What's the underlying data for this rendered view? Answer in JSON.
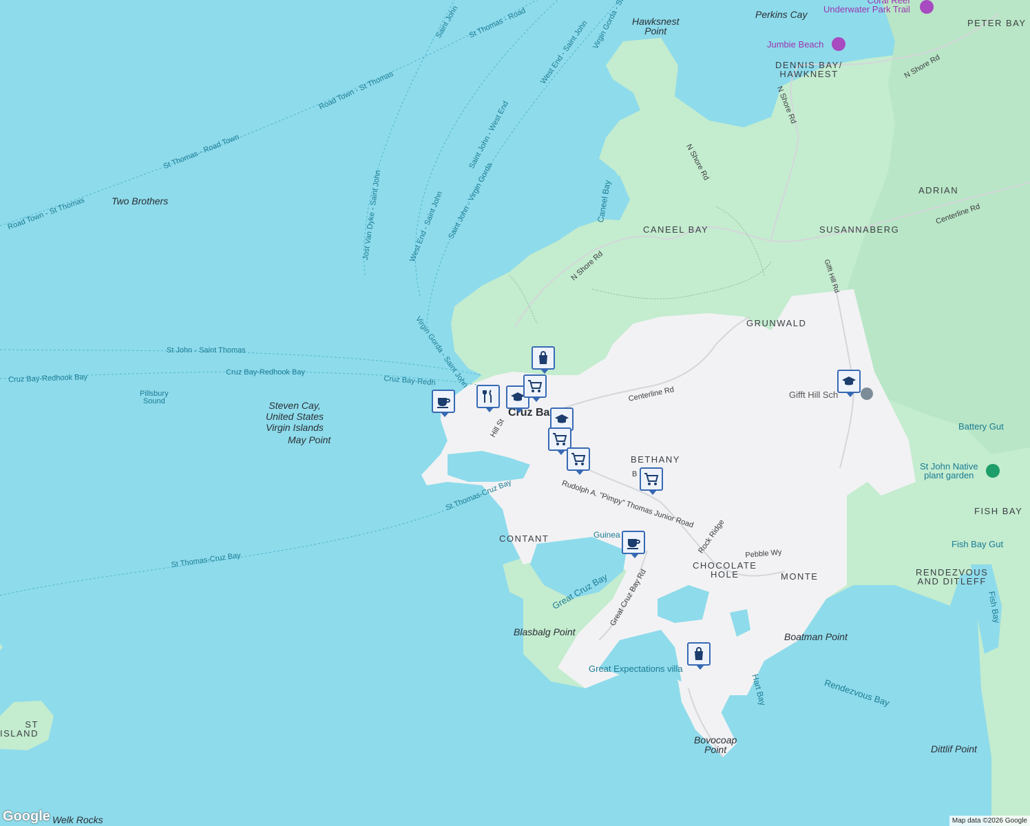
{
  "colors": {
    "water": "#8edbeb",
    "land": "#f2f2f4",
    "park": "#c4eccf",
    "pin": "#3769b3"
  },
  "places": {
    "hawksnest": "Hawksnest\nPoint",
    "perkins": "Perkins Cay",
    "coral_reef": "Coral Reef\nUnderwater Park Trail",
    "jumbie": "Jumbie Beach",
    "peter_bay": "PETER BAY",
    "dennis_bay": "DENNIS BAY/\nHAWKNEST",
    "adrian": "ADRIAN",
    "susannaberg": "SUSANNABERG",
    "caneel_bay": "CANEEL BAY",
    "caneel_bay_water": "Caneel Bay",
    "grunwald": "GRUNWALD",
    "gifft_hill": "Gifft Hill Sch",
    "battery_gut": "Battery Gut",
    "native_garden": "St John Native\nplant garden",
    "fish_bay": "FISH BAY",
    "fish_bay_gut": "Fish Bay Gut",
    "rendezvous": "RENDEZVOUS\nAND DITLEFF",
    "fish_bay_water": "Fish Bay",
    "bethany": "BETHANY",
    "contant": "CONTANT",
    "chocolate_hole": "CHOCOLATE\nHOLE",
    "monte": "MONTE",
    "great_cruz_bay": "Great Cruz Bay",
    "blasbalg": "Blasbalg Point",
    "boatman": "Boatman Point",
    "great_expectations": "Great Expectations villa",
    "hart_bay": "Hart Bay",
    "rendezvous_bay": "Rendezvous Bay",
    "dittlif": "Dittlif Point",
    "bovocoap": "Bovocoap\nPoint",
    "two_brothers": "Two Brothers",
    "pillsbury": "Pillsbury\nSound",
    "steven_cay": "Steven Cay,\nUnited States\nVirgin Islands",
    "may_point": "May Point",
    "cruz_bay": "Cruz Bay",
    "st_island": "ST\nISLAND",
    "welk_rocks": "Welk Rocks",
    "guinea": "Guinea"
  },
  "roads": {
    "n_shore_1": "N Shore Rd",
    "n_shore_2": "N Shore Rd",
    "n_shore_3": "N Shore Rd",
    "n_shore_4": "N Shore Rd",
    "centerline_1": "Centerline Rd",
    "centerline_2": "Centerline Rd",
    "gifft_hill_rd": "Gifft Hill Rd",
    "hill_st": "Hill St",
    "rudolph": "Rudolph A. \"Pimpy\" Thomas Junior Road",
    "bethany_rd": "B     Rd",
    "rock_ridge": "Rock Ridge",
    "pebble": "Pebble Wy",
    "great_cruz_rd": "Great Cruz Bay Rd"
  },
  "ferries": {
    "f1": "St Thomas - Road",
    "f2": "Saint John",
    "f3": "Road Town - St Thomas",
    "f4": "St Thomas - Road Town",
    "f5": "Road Town - St Thomas",
    "f6": "Jost Van Dyke - Saint John",
    "f7": "West End - Saint John",
    "f8": "Saint John - West End",
    "f9": "West End - Saint John",
    "f10": "Saint John - Virgin Gorda",
    "f11": "Virgin Gorda - Sa",
    "f12": "Virgin Gorda - Saint John",
    "f13": "St John - Saint Thomas",
    "f14": "Cruz Bay-Redhook Bay",
    "f15": "Cruz Bay-Redhook Bay",
    "f16": "Cruz Bay-Redh",
    "f17": "St Thomas-Cruz Bay",
    "f18": "St Thomas-Cruz Bay"
  },
  "pins": [
    {
      "icon": "shopping-bag-icon"
    },
    {
      "icon": "restaurant-icon"
    },
    {
      "icon": "school-icon"
    },
    {
      "icon": "cafe-icon"
    },
    {
      "icon": "grocery-cart-icon"
    },
    {
      "icon": "school-icon"
    },
    {
      "icon": "grocery-cart-icon"
    },
    {
      "icon": "grocery-cart-icon"
    },
    {
      "icon": "grocery-cart-icon"
    },
    {
      "icon": "cafe-icon"
    },
    {
      "icon": "school-icon"
    },
    {
      "icon": "shopping-bag-icon"
    }
  ],
  "footer": {
    "attribution": "Map data ©2026 Google",
    "logo": "Google"
  }
}
